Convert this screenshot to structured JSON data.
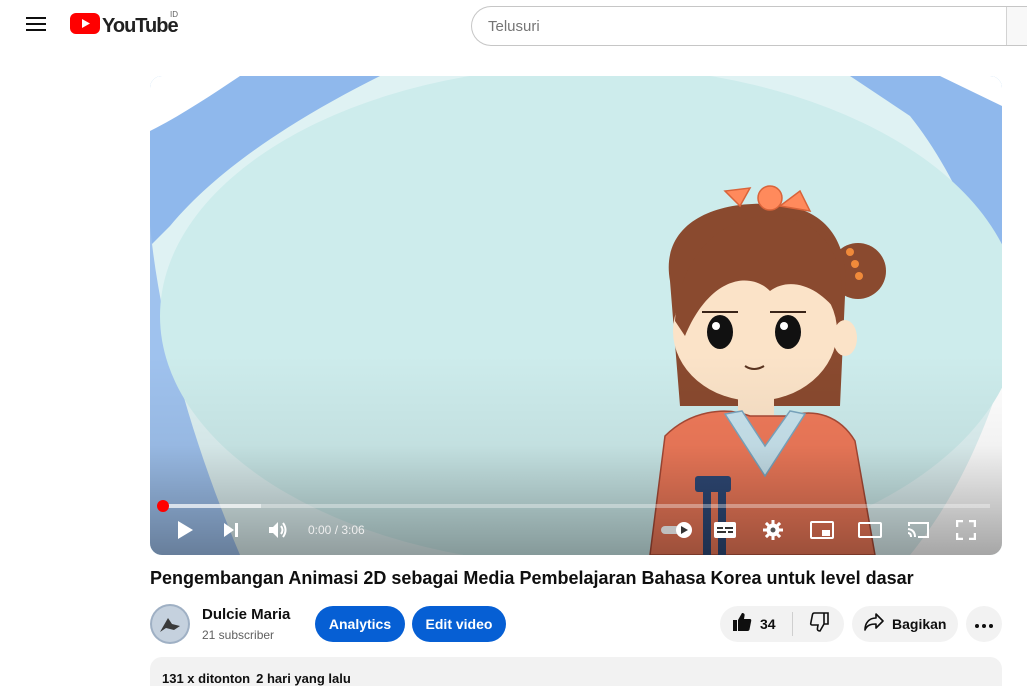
{
  "masthead": {
    "logo_text": "YouTube",
    "country_code": "ID",
    "search_placeholder": "Telusuri",
    "icons": {
      "menu": "hamburger-menu-icon",
      "logo": "youtube-play-icon"
    },
    "brand_color": "#ff0000"
  },
  "player": {
    "time_current": "0:00",
    "time_separator": " / ",
    "time_total": "3:06",
    "progress_fraction": 0.0,
    "buffered_fraction": 0.12,
    "icons": [
      "play-icon",
      "next-icon",
      "volume-icon",
      "autoplay-toggle-icon",
      "subtitles-icon",
      "settings-icon",
      "miniplayer-icon",
      "theater-mode-icon",
      "cast-icon",
      "fullscreen-icon"
    ]
  },
  "video": {
    "title": "Pengembangan Animasi 2D sebagai Media Pembelajaran Bahasa Korea untuk level dasar",
    "channel_name": "Dulcie Maria",
    "subscribers": "21 subscriber",
    "analytics_label": "Analytics",
    "edit_label": "Edit video",
    "like_count": "34",
    "share_label": "Bagikan",
    "views": "131 x ditonton",
    "uploaded": "2 hari yang lalu",
    "accent_color": "#065fd4"
  }
}
